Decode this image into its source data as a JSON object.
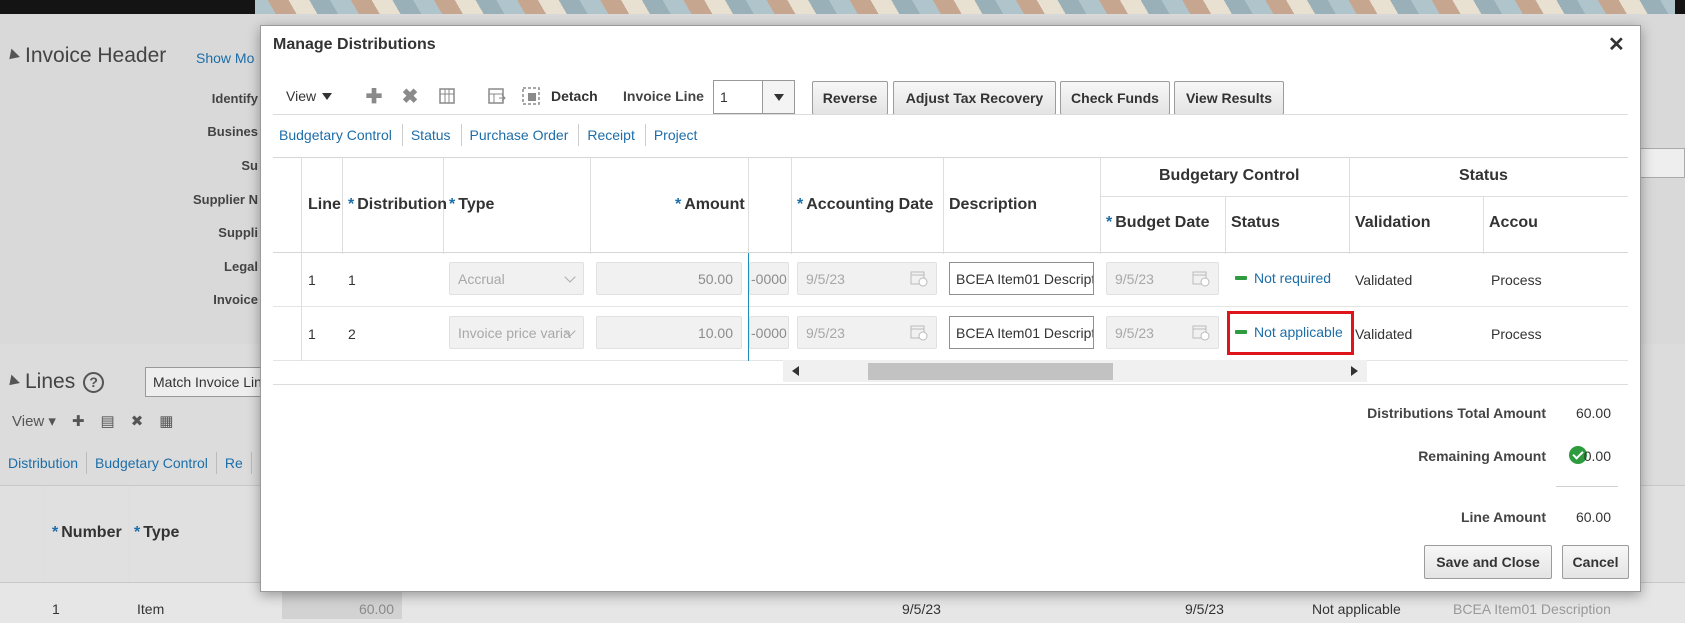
{
  "background": {
    "invoice_header": {
      "title": "Invoice Header",
      "show_more": "Show Mo",
      "labels": [
        "Identify",
        "Busines",
        "Su",
        "Supplier N",
        "Suppli",
        "Legal",
        "Invoice"
      ]
    },
    "lines": {
      "title": "Lines",
      "help": "?",
      "match_button": "Match Invoice Lin",
      "view_label": "View",
      "links": [
        "Distribution",
        "Budgetary Control",
        "Re"
      ],
      "columns": [
        "Number",
        "Type"
      ],
      "row": {
        "number": "1",
        "type": "Item",
        "amount": "60.00",
        "date1": "9/5/23",
        "date2": "9/5/23",
        "status": "Not applicable",
        "description": "BCEA Item01 Description"
      }
    }
  },
  "dialog": {
    "title": "Manage Distributions",
    "close_glyph": "✕",
    "toolbar": {
      "view_label": "View",
      "detach_label": "Detach",
      "invoice_line_label": "Invoice Line",
      "invoice_line_value": "1",
      "buttons": {
        "reverse": "Reverse",
        "adjust_tax": "Adjust Tax Recovery",
        "check_funds": "Check Funds",
        "view_results": "View Results"
      }
    },
    "links": [
      "Budgetary Control",
      "Status",
      "Purchase Order",
      "Receipt",
      "Project"
    ],
    "table": {
      "headers": {
        "line": "Line",
        "distribution": "Distribution",
        "type": "Type",
        "amount": "Amount",
        "accounting_date": "Accounting Date",
        "description": "Description",
        "budgetary_control_group": "Budgetary Control",
        "budget_date": "Budget Date",
        "bc_status": "Status",
        "status_group": "Status",
        "validation": "Validation",
        "accounting": "Accou"
      },
      "rows": [
        {
          "line": "1",
          "distribution": "1",
          "type": "Accrual",
          "amount": "50.00",
          "account_tail": "-0000",
          "accounting_date": "9/5/23",
          "description": "BCEA Item01 Descript",
          "budget_date": "9/5/23",
          "bc_status": "Not required",
          "validation": "Validated",
          "accounting": "Process"
        },
        {
          "line": "1",
          "distribution": "2",
          "type": "Invoice price varia",
          "amount": "10.00",
          "account_tail": "-0000",
          "accounting_date": "9/5/23",
          "description": "BCEA Item01 Descript",
          "budget_date": "9/5/23",
          "bc_status": "Not applicable",
          "validation": "Validated",
          "accounting": "Process"
        }
      ]
    },
    "summary": {
      "distributions_total_label": "Distributions Total Amount",
      "distributions_total_value": "60.00",
      "remaining_label": "Remaining Amount",
      "remaining_value": "0.00",
      "line_amount_label": "Line Amount",
      "line_amount_value": "60.00"
    },
    "footer": {
      "save_close": "Save and Close",
      "cancel": "Cancel"
    }
  },
  "colors": {
    "link": "#1d6ea8",
    "required_star": "#1d6ea8",
    "status_ok": "#2e9b3e",
    "highlight": "#e0151b"
  }
}
